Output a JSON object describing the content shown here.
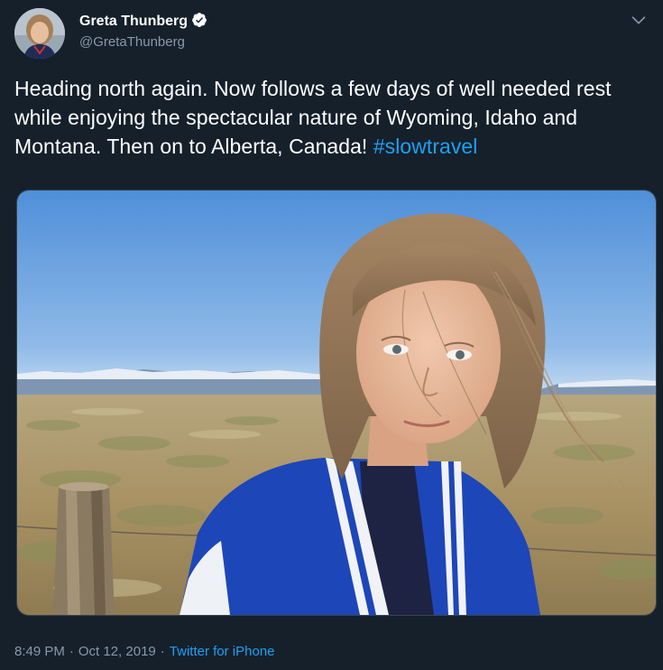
{
  "tweet": {
    "author": {
      "display_name": "Greta Thunberg",
      "handle": "@GretaThunberg",
      "verified_icon": "verified-badge-icon",
      "avatar_icon": "profile-avatar"
    },
    "menu_icon": "chevron-down-icon",
    "text": "Heading north again. Now follows a few days of well needed rest while enjoying the spectacular nature of Wyoming, Idaho and Montana. Then on to Alberta, Canada! ",
    "hashtag": "#slowtravel",
    "media": {
      "type": "photo"
    },
    "time": "8:49 PM",
    "separator": "·",
    "date": "Oct 12, 2019",
    "source": "Twitter for iPhone"
  },
  "colors": {
    "background": "#15202b",
    "text": "#ffffff",
    "secondary_text": "#8899a6",
    "link": "#1da1f2",
    "border": "#38444d"
  }
}
